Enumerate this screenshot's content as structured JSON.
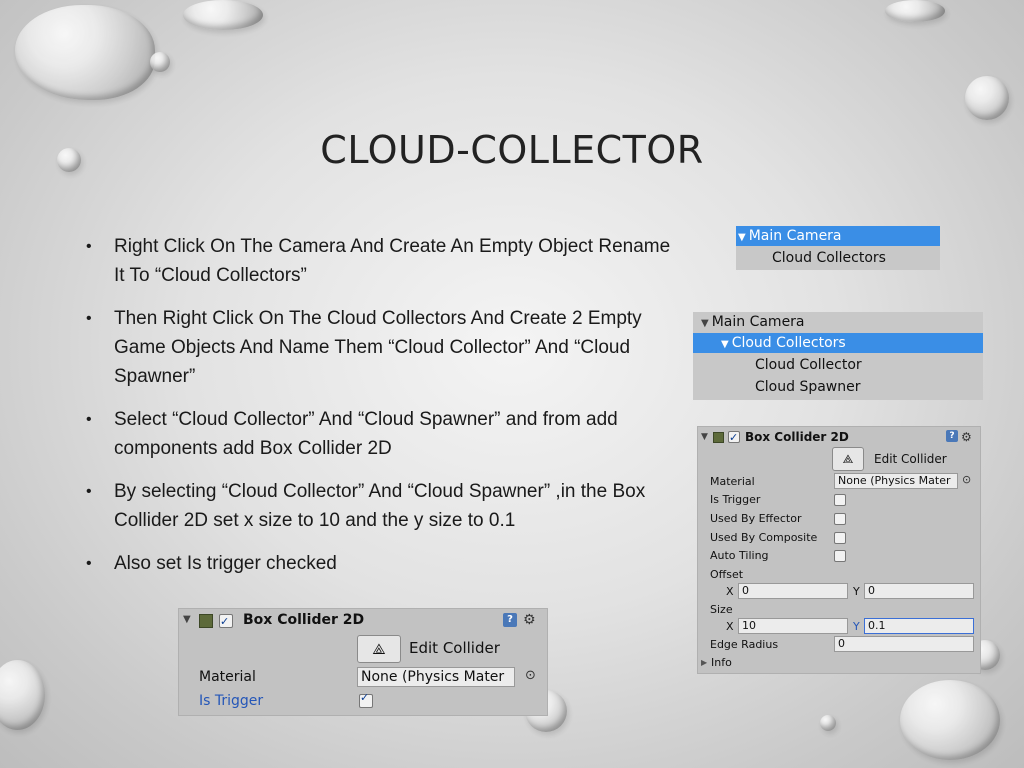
{
  "slide": {
    "title": "CLOUD-COLLECTOR",
    "bullets": [
      "Right Click On The Camera And Create An Empty Object Rename It To “Cloud Collectors”",
      "Then Right Click On The Cloud Collectors And Create 2 Empty Game Objects And Name Them “Cloud Collector” And “Cloud Spawner”",
      "Select “Cloud Collector” And “Cloud Spawner” and from add components add Box Collider 2D",
      "By selecting  “Cloud Collector” And “Cloud Spawner” ,in the Box Collider 2D set x size to 10 and the y size to 0.1",
      "Also set Is trigger checked"
    ]
  },
  "hierarchy1": {
    "rows": [
      "Main Camera",
      "Cloud Collectors"
    ]
  },
  "hierarchy2": {
    "rows": [
      "Main Camera",
      "Cloud Collectors",
      "Cloud Collector",
      "Cloud Spawner"
    ]
  },
  "inspector_small": {
    "component": "Box Collider 2D",
    "edit_label": "Edit Collider",
    "material_label": "Material",
    "material_value": "None (Physics Mater",
    "is_trigger_label": "Is Trigger",
    "is_trigger_checked": true
  },
  "inspector_large": {
    "component": "Box Collider 2D",
    "edit_label": "Edit Collider",
    "material_label": "Material",
    "material_value": "None (Physics Mater",
    "is_trigger_label": "Is Trigger",
    "used_by_effector_label": "Used By Effector",
    "used_by_composite_label": "Used By Composite",
    "auto_tiling_label": "Auto Tiling",
    "offset_label": "Offset",
    "offset_x_label": "X",
    "offset_x": "0",
    "offset_y_label": "Y",
    "offset_y": "0",
    "size_label": "Size",
    "size_x_label": "X",
    "size_x": "10",
    "size_y_label": "Y",
    "size_y": "0.1",
    "edge_radius_label": "Edge Radius",
    "edge_radius": "0",
    "info_label": "Info"
  },
  "icons": {
    "bullet": "•",
    "expand": "▼",
    "collapsed": "▶",
    "gear": "⚙",
    "book": "?",
    "target": "⊙",
    "edit": "⟁"
  },
  "colors": {
    "selection": "#3a8ee6",
    "panel": "#c8c8c8"
  }
}
